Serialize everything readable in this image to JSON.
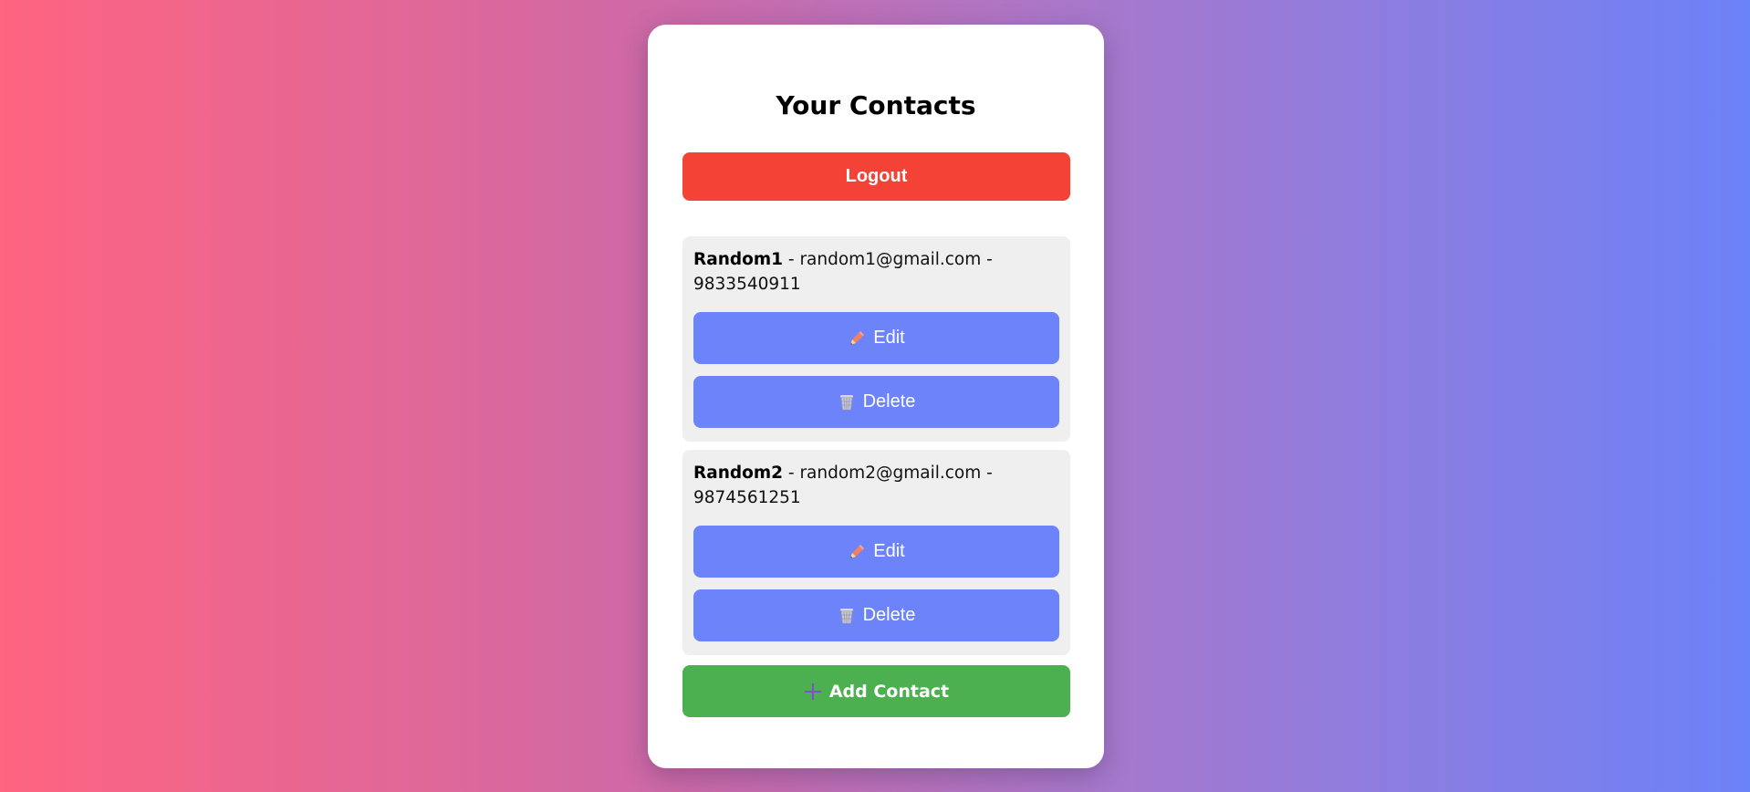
{
  "page": {
    "title": "Your Contacts"
  },
  "logout": {
    "label": "Logout"
  },
  "contacts": [
    {
      "name": "Random1",
      "email": "random1@gmail.com",
      "phone": "9833540911",
      "edit_label": "Edit",
      "delete_label": "Delete"
    },
    {
      "name": "Random2",
      "email": "random2@gmail.com",
      "phone": "9874561251",
      "edit_label": "Edit",
      "delete_label": "Delete"
    }
  ],
  "separator": " - ",
  "add_contact": {
    "label": "Add Contact"
  },
  "icons": {
    "edit": "pencil-icon",
    "delete": "wastebasket-icon",
    "add": "plus-icon"
  },
  "colors": {
    "logout": "#f44336",
    "action": "#6c83f9",
    "add": "#4caf50",
    "card": "#ffffff",
    "contact_bg": "#efefef"
  }
}
